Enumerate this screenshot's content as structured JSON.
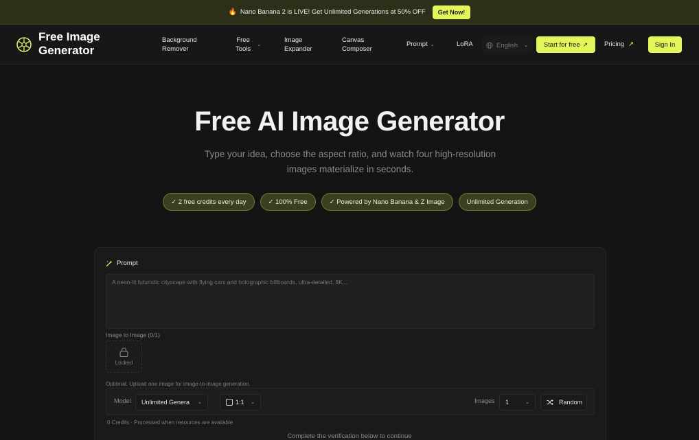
{
  "promo": {
    "icon": "fire-icon",
    "text": "Nano Banana 2 is LIVE! Get Unlimited Generations at 50% OFF",
    "cta": "Get Now!"
  },
  "header": {
    "logo_icon": "aperture-icon",
    "brand_line1": "Free Image",
    "brand_line2": "Generator",
    "nav": {
      "bg_remover_1": "Background",
      "bg_remover_2": "Remover",
      "free_tools_1": "Free",
      "free_tools_2": "Tools",
      "image_expander_1": "Image",
      "image_expander_2": "Expander",
      "canvas_composer_1": "Canvas",
      "canvas_composer_2": "Composer",
      "prompt": "Prompt",
      "lora": "LoRA"
    },
    "language": "English",
    "start_free": "Start for free",
    "pricing": "Pricing",
    "sign_in": "Sign In"
  },
  "hero": {
    "title": "Free AI Image Generator",
    "subtitle": "Type your idea, choose the aspect ratio, and watch four high-resolution images materialize in seconds.",
    "badges": {
      "b1": "✓ 2 free credits every day",
      "b2": "✓ 100% Free",
      "b3": "✓ Powered by Nano Banana & Z Image",
      "b4": "Unlimited Generation"
    }
  },
  "form": {
    "prompt_label": "Prompt",
    "prompt_placeholder": "A neon-lit futuristic cityscape with flying cars and holographic billboards, ultra-detailed, 8K...",
    "i2i_label": "Image to Image (0/1)",
    "locked_label": "Locked",
    "i2i_hint": "Optional. Upload one image for image-to-image generation.",
    "model_label": "Model",
    "model_value": "Unlimited Genera",
    "ratio_value": "1:1",
    "images_label": "Images",
    "images_value": "1",
    "random_label": "Random",
    "credits_note": "0 Credits · Processed when resources are available",
    "verify_note": "Complete the verification below to continue"
  },
  "colors": {
    "accent": "#e3f55a",
    "banner_bg": "#2d3019",
    "badge_bg": "#3a3f1f",
    "badge_border": "#6d7a30",
    "page_bg": "#141414"
  }
}
